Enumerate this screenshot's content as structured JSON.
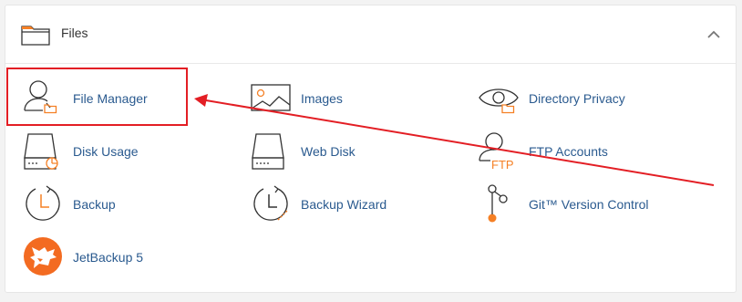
{
  "section": {
    "title": "Files",
    "folder_icon": "folder-icon",
    "collapse_icon": "chevron-up-icon"
  },
  "items": [
    {
      "label": "File Manager",
      "icon": "file-manager-icon"
    },
    {
      "label": "Images",
      "icon": "images-icon"
    },
    {
      "label": "Directory Privacy",
      "icon": "directory-privacy-icon"
    },
    {
      "label": "Disk Usage",
      "icon": "disk-usage-icon"
    },
    {
      "label": "Web Disk",
      "icon": "web-disk-icon"
    },
    {
      "label": "FTP Accounts",
      "icon": "ftp-accounts-icon",
      "icon_text": "FTP"
    },
    {
      "label": "Backup",
      "icon": "backup-icon"
    },
    {
      "label": "Backup Wizard",
      "icon": "backup-wizard-icon"
    },
    {
      "label": "Git™ Version Control",
      "icon": "git-icon"
    },
    {
      "label": "JetBackup 5",
      "icon": "jetbackup-icon"
    }
  ],
  "colors": {
    "label": "#2a5a8f",
    "icon_stroke": "#333333",
    "accent": "#f58025",
    "annotation": "#e31e24"
  }
}
